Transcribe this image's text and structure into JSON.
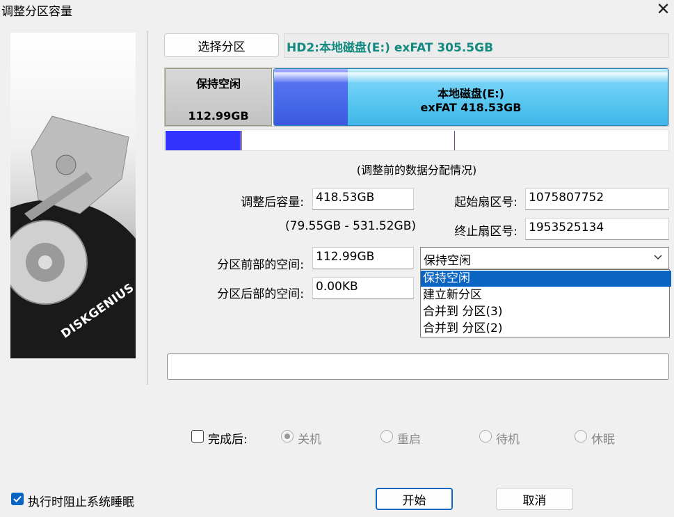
{
  "window": {
    "title": "调整分区容量",
    "close_glyph": "✕"
  },
  "sidebar": {
    "logo_text": "DISKGENIUS"
  },
  "select_partition_label": "选择分区",
  "disk_name": "HD2:本地磁盘(E:) exFAT 305.5GB",
  "partitions": {
    "free": {
      "label": "保持空闲",
      "size": "112.99GB",
      "color": "#c8c8c8"
    },
    "exfat": {
      "label": "本地磁盘(E:)",
      "detail": "exFAT 418.53GB",
      "color": "#4cc0ee",
      "used_color": "#4669ea"
    }
  },
  "data_map": {
    "used_color": "#3333ff",
    "used_fraction": 0.15
  },
  "caption": "(调整前的数据分配情况)",
  "form": {
    "size_after_label": "调整后容量:",
    "size_after_value": "418.53GB",
    "size_range": "(79.55GB - 531.52GB)",
    "start_sector_label": "起始扇区号:",
    "start_sector_value": "1075807752",
    "end_sector_label": "终止扇区号:",
    "end_sector_value": "1953525134",
    "space_before_label": "分区前部的空间:",
    "space_before_value": "112.99GB",
    "space_after_label": "分区后部的空间:",
    "space_after_value": "0.00KB"
  },
  "combo": {
    "selected": "保持空闲",
    "options": [
      "保持空闲",
      "建立新分区",
      "合并到 分区(3)",
      "合并到 分区(2)"
    ]
  },
  "after_complete": {
    "label": "完成后:",
    "options": [
      "关机",
      "重启",
      "待机",
      "休眠"
    ],
    "selected": "关机"
  },
  "prevent_sleep_label": "执行时阻止系统睡眠",
  "start_button": "开始",
  "cancel_button": "取消",
  "accent_color": "#0a64c2"
}
